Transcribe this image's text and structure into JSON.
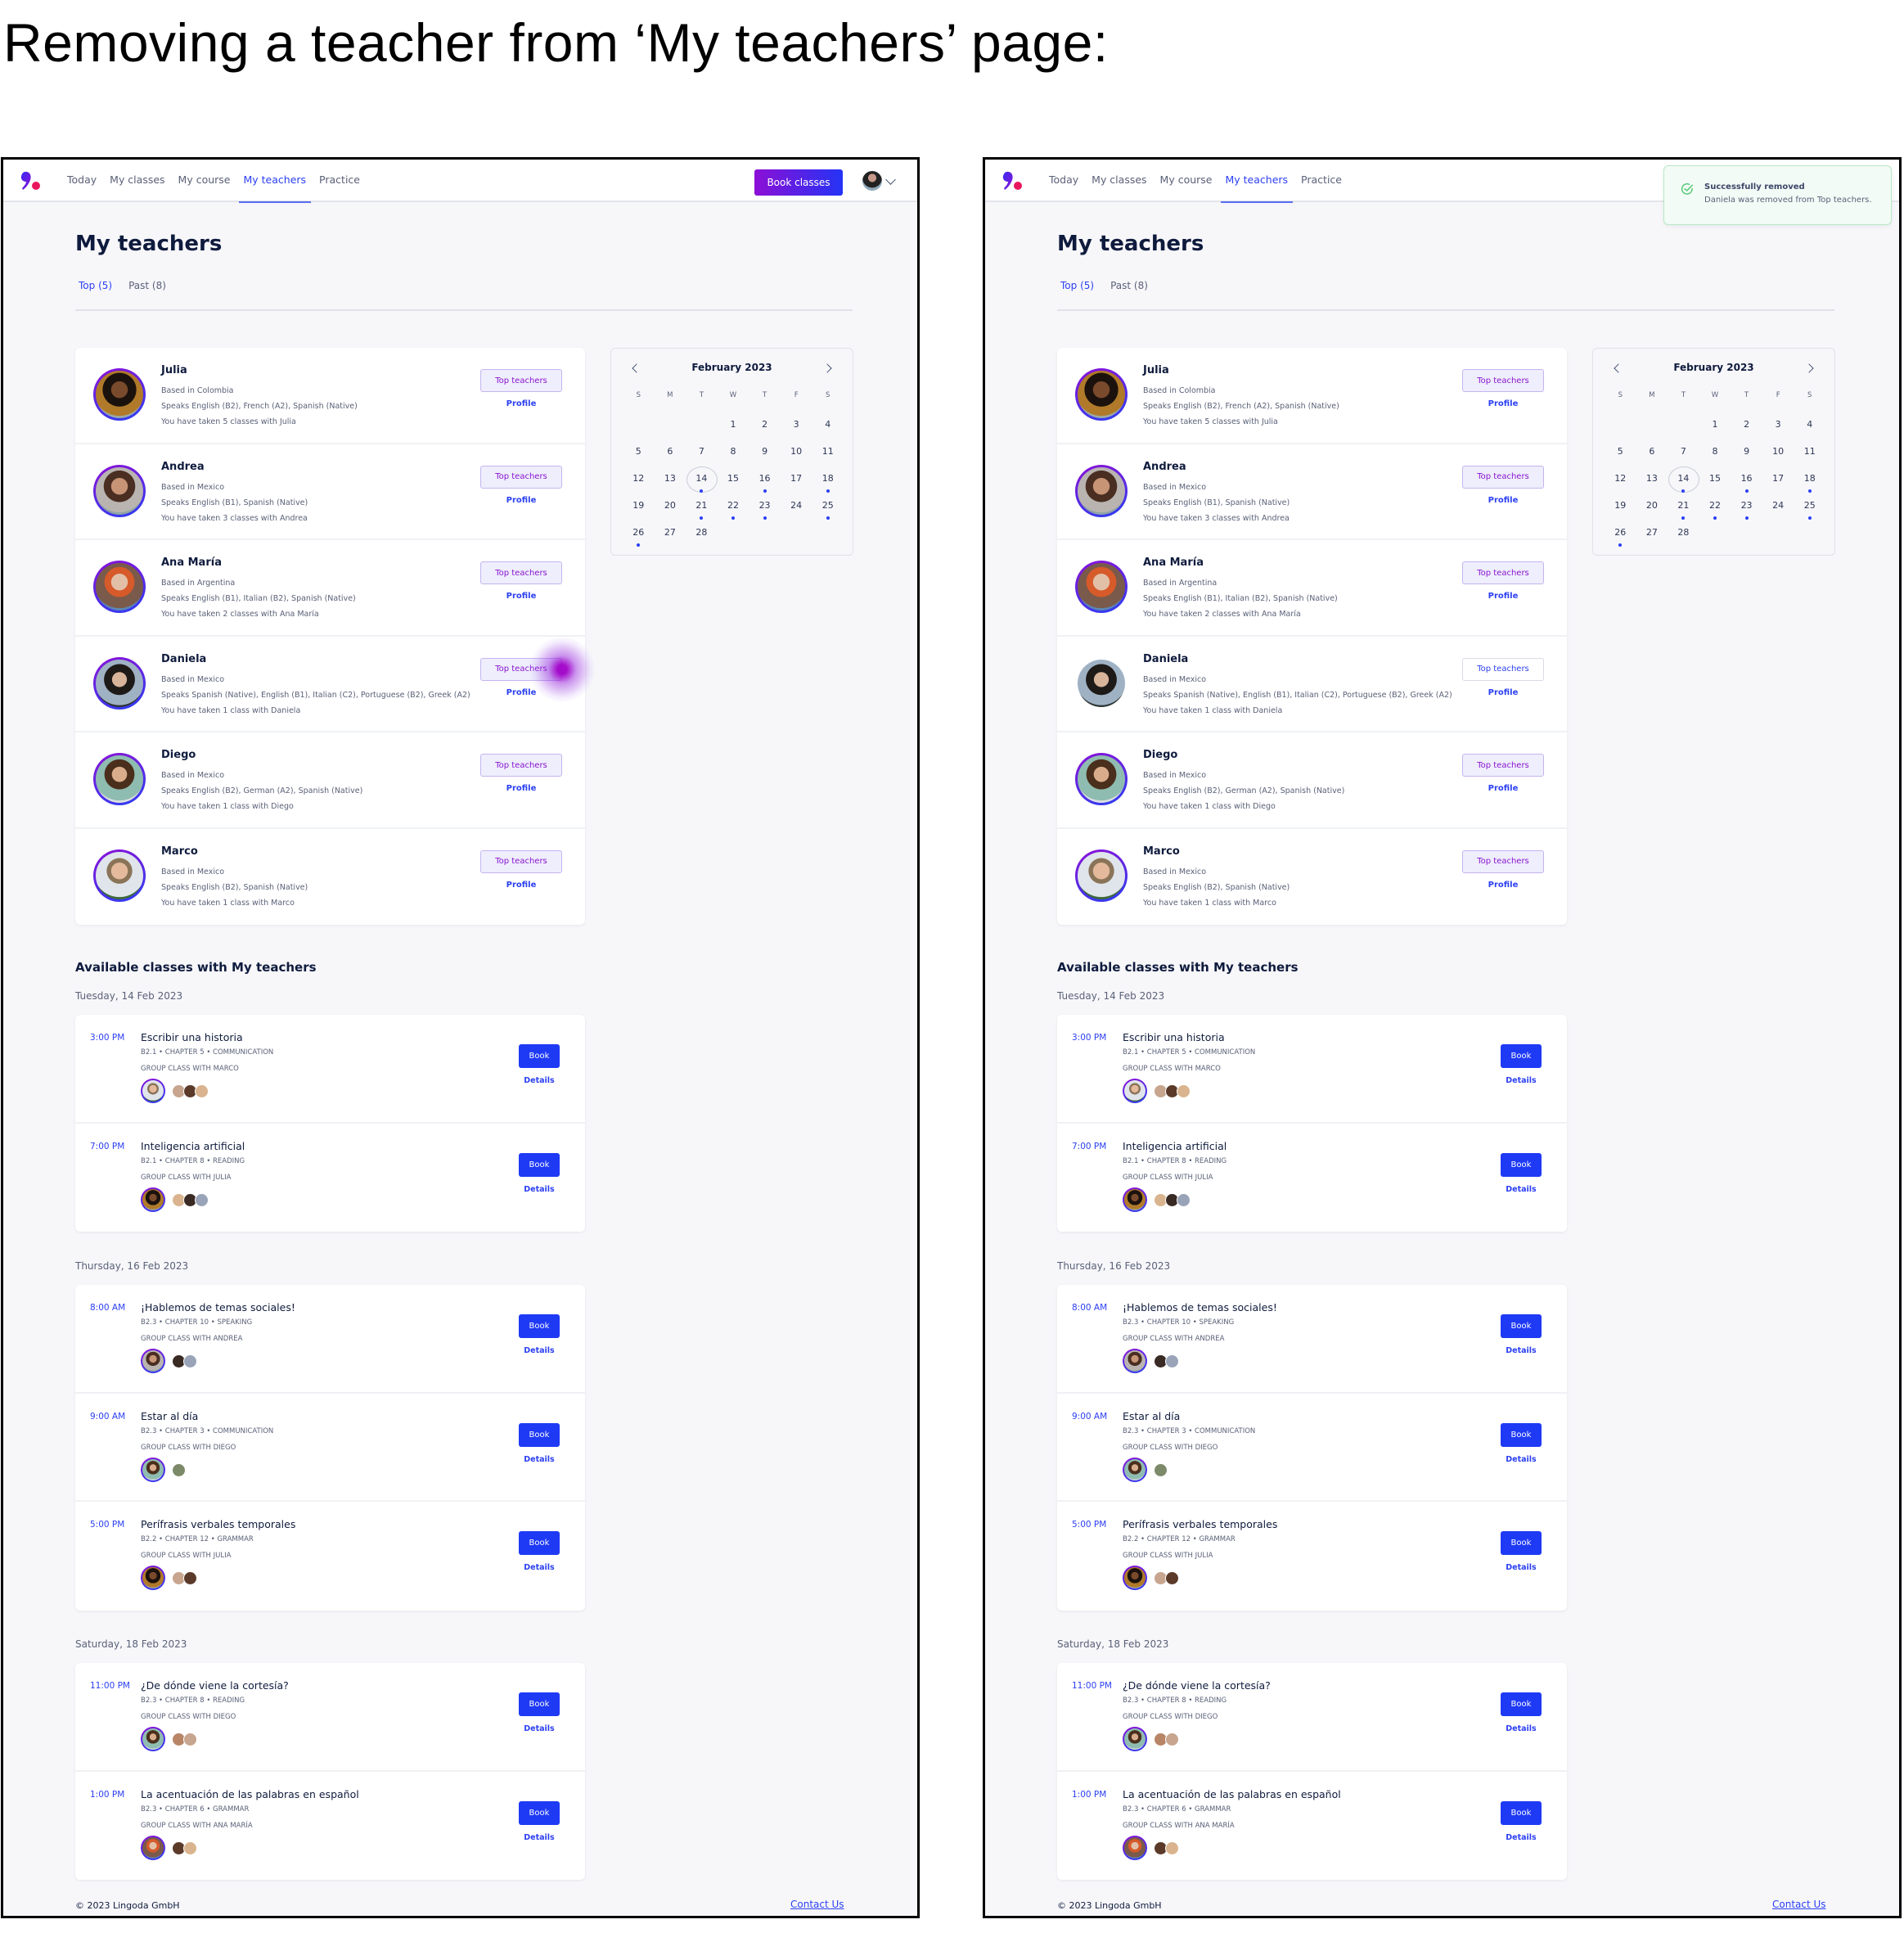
{
  "caption": "Removing a teacher from ‘My teachers’ page:",
  "colors": {
    "brand_blue": "#2b3ff2",
    "brand_purple": "#8c0fd6",
    "book_button": "#1f3af5",
    "success_green": "#4cc66f"
  },
  "screens": [
    {
      "nav": {
        "items": [
          "Today",
          "My classes",
          "My course",
          "My teachers",
          "Practice"
        ],
        "active": "My teachers",
        "book_classes_label": "Book classes"
      },
      "toast": null,
      "page_title": "My teachers",
      "tabs": [
        {
          "label": "Top (5)",
          "active": true
        },
        {
          "label": "Past (8)",
          "active": false
        }
      ],
      "teachers": [
        {
          "name": "Julia",
          "based": "Based in Colombia",
          "speaks": "Speaks English (B2), French (A2), Spanish (Native)",
          "taken": "You have taken 5 classes with Julia",
          "button": "Top teachers",
          "in_top": true,
          "profile": "Profile"
        },
        {
          "name": "Andrea",
          "based": "Based in Mexico",
          "speaks": "Speaks English (B1), Spanish (Native)",
          "taken": "You have taken 3 classes with Andrea",
          "button": "Top teachers",
          "in_top": true,
          "profile": "Profile"
        },
        {
          "name": "Ana María",
          "based": "Based in Argentina",
          "speaks": "Speaks English (B1), Italian (B2), Spanish (Native)",
          "taken": "You have taken 2 classes with Ana María",
          "button": "Top teachers",
          "in_top": true,
          "profile": "Profile"
        },
        {
          "name": "Daniela",
          "based": "Based in Mexico",
          "speaks": "Speaks Spanish (Native), English (B1), Italian (C2), Portuguese (B2), Greek (A2)",
          "taken": "You have taken 1 class with Daniela",
          "button": "Top teachers",
          "in_top": true,
          "profile": "Profile",
          "tapped": true
        },
        {
          "name": "Diego",
          "based": "Based in Mexico",
          "speaks": "Speaks English (B2), German (A2), Spanish (Native)",
          "taken": "You have taken 1 class with Diego",
          "button": "Top teachers",
          "in_top": true,
          "profile": "Profile"
        },
        {
          "name": "Marco",
          "based": "Based in Mexico",
          "speaks": "Speaks English (B2), Spanish (Native)",
          "taken": "You have taken 1 class with Marco",
          "button": "Top teachers",
          "in_top": true,
          "profile": "Profile"
        }
      ]
    },
    {
      "nav": {
        "items": [
          "Today",
          "My classes",
          "My course",
          "My teachers",
          "Practice"
        ],
        "active": "My teachers",
        "book_classes_label": "Book classes"
      },
      "toast": {
        "icon": "check-circle-icon",
        "title": "Successfully removed",
        "text": "Daniela was removed from Top teachers."
      },
      "page_title": "My teachers",
      "tabs": [
        {
          "label": "Top (5)",
          "active": true
        },
        {
          "label": "Past (8)",
          "active": false
        }
      ],
      "teachers": [
        {
          "name": "Julia",
          "based": "Based in Colombia",
          "speaks": "Speaks English (B2), French (A2), Spanish (Native)",
          "taken": "You have taken 5 classes with Julia",
          "button": "Top teachers",
          "in_top": true,
          "profile": "Profile"
        },
        {
          "name": "Andrea",
          "based": "Based in Mexico",
          "speaks": "Speaks English (B1), Spanish (Native)",
          "taken": "You have taken 3 classes with Andrea",
          "button": "Top teachers",
          "in_top": true,
          "profile": "Profile"
        },
        {
          "name": "Ana María",
          "based": "Based in Argentina",
          "speaks": "Speaks English (B1), Italian (B2), Spanish (Native)",
          "taken": "You have taken 2 classes with Ana María",
          "button": "Top teachers",
          "in_top": true,
          "profile": "Profile"
        },
        {
          "name": "Daniela",
          "based": "Based in Mexico",
          "speaks": "Speaks Spanish (Native), English (B1), Italian (C2), Portuguese (B2), Greek (A2)",
          "taken": "You have taken 1 class with Daniela",
          "button": "Top teachers",
          "in_top": false,
          "profile": "Profile"
        },
        {
          "name": "Diego",
          "based": "Based in Mexico",
          "speaks": "Speaks English (B2), German (A2), Spanish (Native)",
          "taken": "You have taken 1 class with Diego",
          "button": "Top teachers",
          "in_top": true,
          "profile": "Profile"
        },
        {
          "name": "Marco",
          "based": "Based in Mexico",
          "speaks": "Speaks English (B2), Spanish (Native)",
          "taken": "You have taken 1 class with Marco",
          "button": "Top teachers",
          "in_top": true,
          "profile": "Profile"
        }
      ]
    }
  ],
  "calendar": {
    "month_label": "February 2023",
    "weekdays": [
      "S",
      "M",
      "T",
      "W",
      "T",
      "F",
      "S"
    ],
    "leading_blanks": 3,
    "days": 28,
    "today": 14,
    "days_with_classes": [
      14,
      16,
      18,
      21,
      22,
      23,
      25,
      26
    ]
  },
  "classes_section": {
    "title": "Available classes with My teachers",
    "book_label": "Book",
    "details_label": "Details",
    "days": [
      {
        "date": "Tuesday, 14 Feb 2023",
        "classes": [
          {
            "time": "3:00 PM",
            "title": "Escribir una historia",
            "meta": "B2.1 • CHAPTER 5 • COMMUNICATION",
            "with": "GROUP CLASS WITH MARCO",
            "teacher": "Marco",
            "students": 3
          },
          {
            "time": "7:00 PM",
            "title": "Inteligencia artificial",
            "meta": "B2.1 • CHAPTER 8 • READING",
            "with": "GROUP CLASS WITH JULIA",
            "teacher": "Julia",
            "students": 3
          }
        ]
      },
      {
        "date": "Thursday, 16 Feb 2023",
        "classes": [
          {
            "time": "8:00 AM",
            "title": "¡Hablemos de temas sociales!",
            "meta": "B2.3 • CHAPTER 10 • SPEAKING",
            "with": "GROUP CLASS WITH ANDREA",
            "teacher": "Andrea",
            "students": 2
          },
          {
            "time": "9:00 AM",
            "title": "Estar al día",
            "meta": "B2.3 • CHAPTER 3 • COMMUNICATION",
            "with": "GROUP CLASS WITH DIEGO",
            "teacher": "Diego",
            "students": 1
          },
          {
            "time": "5:00 PM",
            "title": "Perífrasis verbales temporales",
            "meta": "B2.2 • CHAPTER 12 • GRAMMAR",
            "with": "GROUP CLASS WITH JULIA",
            "teacher": "Julia",
            "students": 2
          }
        ]
      },
      {
        "date": "Saturday, 18 Feb 2023",
        "classes": [
          {
            "time": "11:00 PM",
            "title": "¿De dónde viene la cortesía?",
            "meta": "B2.3 • CHAPTER 8 • READING",
            "with": "GROUP CLASS WITH DIEGO",
            "teacher": "Diego",
            "students": 2
          },
          {
            "time": "1:00 PM",
            "title": "La acentuación de las palabras en español",
            "meta": "B2.3 • CHAPTER 6 • GRAMMAR",
            "with": "GROUP CLASS WITH ANA MARÍA",
            "teacher": "Ana María",
            "students": 2
          }
        ]
      }
    ]
  },
  "footer": {
    "copyright": "© 2023 Lingoda GmbH",
    "contact": "Contact Us"
  }
}
